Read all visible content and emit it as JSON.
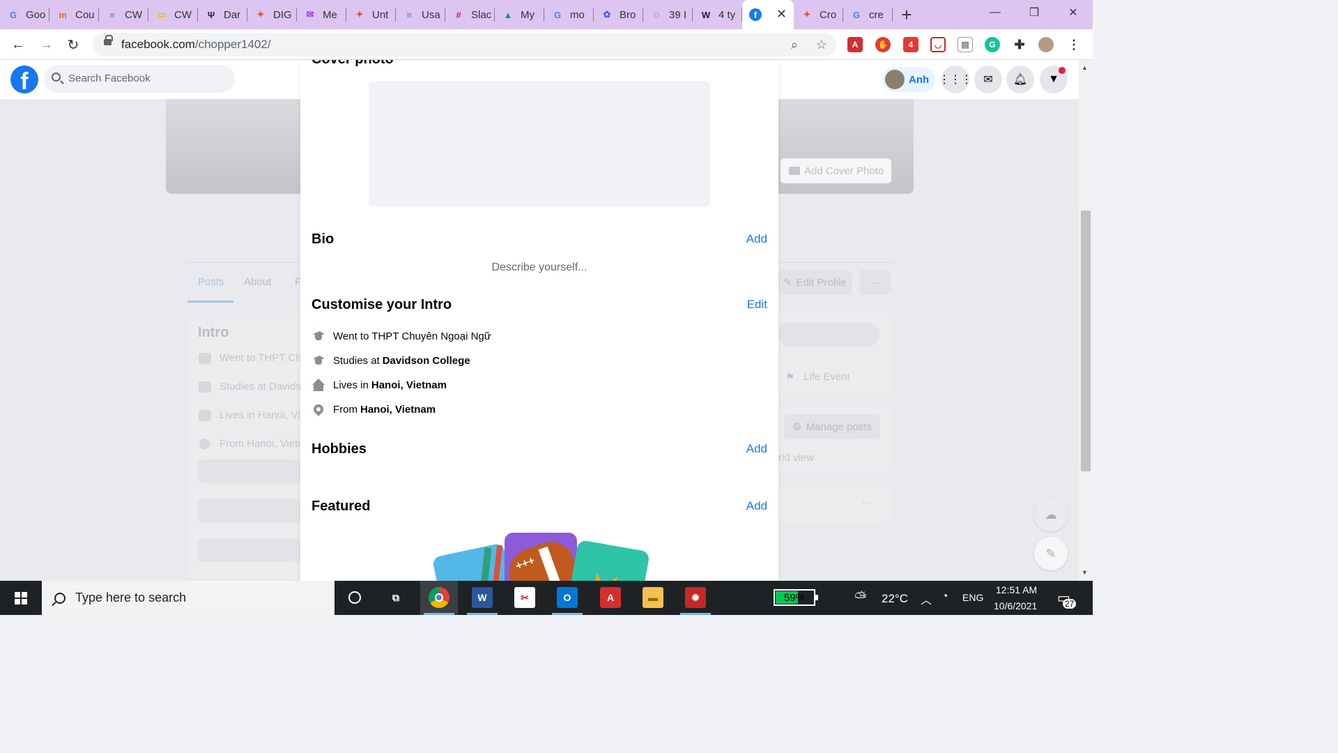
{
  "browser": {
    "tabs": [
      {
        "label": "Goo",
        "icon": "google-icon",
        "color": "#4285f4",
        "glyph": "G"
      },
      {
        "label": "Cou",
        "icon": "coursera-icon",
        "color": "#e8710a",
        "glyph": "m"
      },
      {
        "label": "CW",
        "icon": "google-docs-icon",
        "color": "#4285f4",
        "glyph": "≡"
      },
      {
        "label": "CW",
        "icon": "google-slides-icon",
        "color": "#f4b400",
        "glyph": "▭"
      },
      {
        "label": "Dar",
        "icon": "dartmouth-icon",
        "color": "#2a2a2a",
        "glyph": "Ψ"
      },
      {
        "label": "DIG",
        "icon": "figma-icon",
        "color": "#f24e1e",
        "glyph": "✦"
      },
      {
        "label": "Me",
        "icon": "messenger-icon",
        "color": "#a033ff",
        "glyph": "✉"
      },
      {
        "label": "Unt",
        "icon": "figma-icon",
        "color": "#f24e1e",
        "glyph": "✦"
      },
      {
        "label": "Usa",
        "icon": "google-docs-icon",
        "color": "#4285f4",
        "glyph": "≡"
      },
      {
        "label": "Slac",
        "icon": "slack-icon",
        "color": "#e01e5a",
        "glyph": "#"
      },
      {
        "label": "My",
        "icon": "google-drive-icon",
        "color": "#0f9d58",
        "glyph": "▲"
      },
      {
        "label": "mo",
        "icon": "google-icon",
        "color": "#4285f4",
        "glyph": "G"
      },
      {
        "label": "Bro",
        "icon": "miro-icon",
        "color": "#4262ff",
        "glyph": "✿"
      },
      {
        "label": "39 I",
        "icon": "brain-icon",
        "color": "#e26a8d",
        "glyph": "☺"
      },
      {
        "label": "4 ty",
        "icon": "webflow-icon",
        "color": "#222222",
        "glyph": "W"
      },
      {
        "label": "",
        "icon": "facebook-icon",
        "color": "#1877f2",
        "glyph": "f",
        "active": true
      },
      {
        "label": "Cro",
        "icon": "figma-icon",
        "color": "#f24e1e",
        "glyph": "✦"
      },
      {
        "label": "cre",
        "icon": "google-icon",
        "color": "#4285f4",
        "glyph": "G"
      }
    ],
    "new_tab_label": "+",
    "close_tab_label": "✕",
    "address": {
      "host": "facebook.com",
      "path": "/chopper1402/"
    }
  },
  "facebook": {
    "search_placeholder": "Search Facebook",
    "user_name": "Anh",
    "cover_button": "Add Cover Photo",
    "profile_tabs": [
      "Posts",
      "About",
      "F"
    ],
    "edit_profile": "Edit Profile",
    "more": "···",
    "intro_title": "Intro",
    "intro_bg": [
      "Went to THPT Chu",
      "Studies at Davids",
      "Lives in Hanoi, Vie",
      "From Hanoi, Vietn"
    ],
    "life_event": "Life Event",
    "manage_posts": "Manage posts",
    "grid_view": "rid view"
  },
  "modal": {
    "cut_heading": "Cover photo",
    "bio": {
      "title": "Bio",
      "action": "Add",
      "placeholder": "Describe yourself..."
    },
    "intro": {
      "title": "Customise your Intro",
      "action": "Edit",
      "items": [
        {
          "icon": "graduation-cap-icon",
          "prefix": "Went to THPT Chuyên Ngoại Ngữ",
          "bold": ""
        },
        {
          "icon": "graduation-cap-icon",
          "prefix": "Studies at",
          "bold": "Davidson College"
        },
        {
          "icon": "home-icon",
          "prefix": "Lives in",
          "bold": "Hanoi, Vietnam"
        },
        {
          "icon": "location-pin-icon",
          "prefix": "From",
          "bold": "Hanoi, Vietnam"
        }
      ]
    },
    "hobbies": {
      "title": "Hobbies",
      "action": "Add"
    },
    "featured": {
      "title": "Featured",
      "action": "Add"
    }
  },
  "taskbar": {
    "search_placeholder": "Type here to search",
    "battery": {
      "percent_label": "59%",
      "level": 0.59
    },
    "temperature": "22°C",
    "language": "ENG",
    "time": "12:51 AM",
    "date": "10/6/2021",
    "notifications": "27"
  }
}
